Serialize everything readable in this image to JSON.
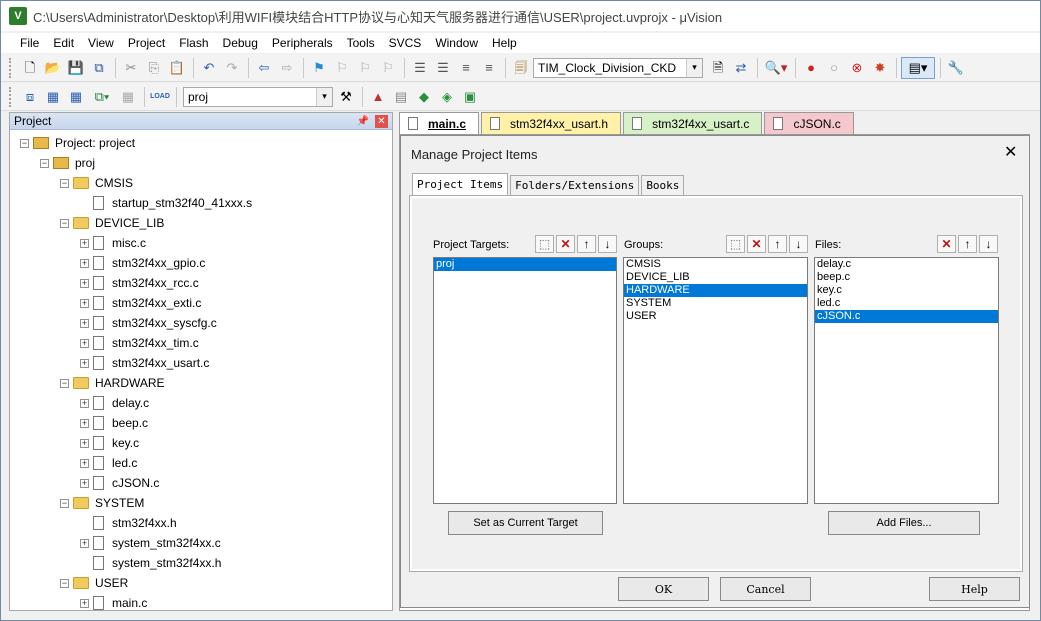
{
  "window": {
    "title": "C:\\Users\\Administrator\\Desktop\\利用WIFI模块结合HTTP协议与心知天气服务器进行通信\\USER\\project.uvprojx - μVision"
  },
  "menu": [
    "File",
    "Edit",
    "View",
    "Project",
    "Flash",
    "Debug",
    "Peripherals",
    "Tools",
    "SVCS",
    "Window",
    "Help"
  ],
  "toolbar": {
    "target_combo": "TIM_Clock_Division_CKD",
    "project_combo": "proj",
    "load_label": "LOAD"
  },
  "project_panel": {
    "title": "Project",
    "tree": [
      {
        "label": "Project: project",
        "level": 0,
        "type": "root"
      },
      {
        "label": "proj",
        "level": 1,
        "type": "target"
      },
      {
        "label": "CMSIS",
        "level": 2,
        "type": "folder"
      },
      {
        "label": "startup_stm32f40_41xxx.s",
        "level": 3,
        "type": "file",
        "plus": false
      },
      {
        "label": "DEVICE_LIB",
        "level": 2,
        "type": "folder"
      },
      {
        "label": "misc.c",
        "level": 3,
        "type": "file",
        "plus": true
      },
      {
        "label": "stm32f4xx_gpio.c",
        "level": 3,
        "type": "file",
        "plus": true
      },
      {
        "label": "stm32f4xx_rcc.c",
        "level": 3,
        "type": "file",
        "plus": true
      },
      {
        "label": "stm32f4xx_exti.c",
        "level": 3,
        "type": "file",
        "plus": true
      },
      {
        "label": "stm32f4xx_syscfg.c",
        "level": 3,
        "type": "file",
        "plus": true
      },
      {
        "label": "stm32f4xx_tim.c",
        "level": 3,
        "type": "file",
        "plus": true
      },
      {
        "label": "stm32f4xx_usart.c",
        "level": 3,
        "type": "file",
        "plus": true
      },
      {
        "label": "HARDWARE",
        "level": 2,
        "type": "folder"
      },
      {
        "label": "delay.c",
        "level": 3,
        "type": "file",
        "plus": true
      },
      {
        "label": "beep.c",
        "level": 3,
        "type": "file",
        "plus": true
      },
      {
        "label": "key.c",
        "level": 3,
        "type": "file",
        "plus": true
      },
      {
        "label": "led.c",
        "level": 3,
        "type": "file",
        "plus": true
      },
      {
        "label": "cJSON.c",
        "level": 3,
        "type": "file",
        "plus": true
      },
      {
        "label": "SYSTEM",
        "level": 2,
        "type": "folder"
      },
      {
        "label": "stm32f4xx.h",
        "level": 3,
        "type": "file",
        "plus": false
      },
      {
        "label": "system_stm32f4xx.c",
        "level": 3,
        "type": "file",
        "plus": true
      },
      {
        "label": "system_stm32f4xx.h",
        "level": 3,
        "type": "file",
        "plus": false
      },
      {
        "label": "USER",
        "level": 2,
        "type": "folder"
      },
      {
        "label": "main.c",
        "level": 3,
        "type": "file",
        "plus": true
      }
    ]
  },
  "editor_tabs": [
    {
      "label": "main.c",
      "color": "#ffffff",
      "active": true
    },
    {
      "label": "stm32f4xx_usart.h",
      "color": "#fff2a8"
    },
    {
      "label": "stm32f4xx_usart.c",
      "color": "#d8f0c8"
    },
    {
      "label": "cJSON.c",
      "color": "#f4c8cc"
    }
  ],
  "dialog": {
    "title": "Manage Project Items",
    "tabs": [
      "Project Items",
      "Folders/Extensions",
      "Books"
    ],
    "targets": {
      "label": "Project Targets:",
      "items": [
        "proj"
      ],
      "selected": 0
    },
    "groups": {
      "label": "Groups:",
      "items": [
        "CMSIS",
        "DEVICE_LIB",
        "HARDWARE",
        "SYSTEM",
        "USER"
      ],
      "selected": 2
    },
    "files": {
      "label": "Files:",
      "items": [
        "delay.c",
        "beep.c",
        "key.c",
        "led.c",
        "cJSON.c"
      ],
      "selected": 4
    },
    "set_target_button": "Set as Current Target",
    "add_files_button": "Add Files...",
    "ok_button": "OK",
    "cancel_button": "Cancel",
    "help_button": "Help"
  }
}
